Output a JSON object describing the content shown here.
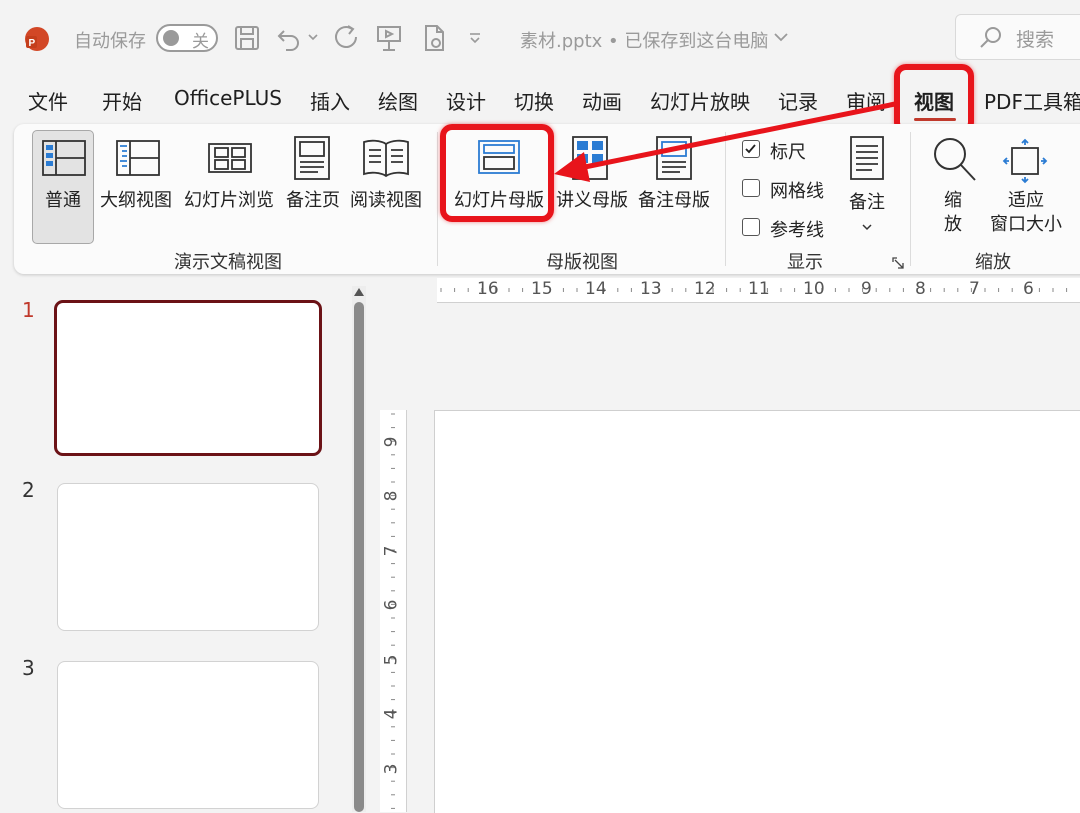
{
  "titlebar": {
    "autosave_label": "自动保存",
    "autosave_toggle": "关",
    "doc_title": "素材.pptx • 已保存到这台电脑",
    "search_placeholder": "搜索"
  },
  "tabs": [
    {
      "label": "文件"
    },
    {
      "label": "开始"
    },
    {
      "label": "OfficePLUS"
    },
    {
      "label": "插入"
    },
    {
      "label": "绘图"
    },
    {
      "label": "设计"
    },
    {
      "label": "切换"
    },
    {
      "label": "动画"
    },
    {
      "label": "幻灯片放映"
    },
    {
      "label": "记录"
    },
    {
      "label": "审阅"
    },
    {
      "label": "视图"
    },
    {
      "label": "PDF工具箱"
    }
  ],
  "ribbon": {
    "presentation_views": {
      "label": "演示文稿视图",
      "buttons": [
        "普通",
        "大纲视图",
        "幻灯片浏览",
        "备注页",
        "阅读视图"
      ]
    },
    "master_views": {
      "label": "母版视图",
      "buttons": [
        "幻灯片母版",
        "讲义母版",
        "备注母版"
      ]
    },
    "show": {
      "label": "显示",
      "checkboxes": [
        {
          "label": "标尺",
          "checked": true
        },
        {
          "label": "网格线",
          "checked": false
        },
        {
          "label": "参考线",
          "checked": false
        }
      ],
      "notes_button": "备注"
    },
    "zoom": {
      "label": "缩放",
      "zoom_button_line1": "缩",
      "zoom_button_line2": "放",
      "fit_button_line1": "适应",
      "fit_button_line2": "窗口大小"
    }
  },
  "slides": {
    "numbers": [
      "1",
      "2",
      "3"
    ],
    "selected": "1"
  },
  "ruler": {
    "horizontal": [
      "16",
      "15",
      "14",
      "13",
      "12",
      "11",
      "10",
      "9",
      "8",
      "7",
      "6"
    ],
    "vertical": [
      "9",
      "8",
      "7",
      "6",
      "5",
      "4",
      "3"
    ]
  },
  "colors": {
    "highlight": "#e8141b",
    "selected_slide_border": "#6b1216",
    "active_tab_underline": "#c0392b"
  }
}
